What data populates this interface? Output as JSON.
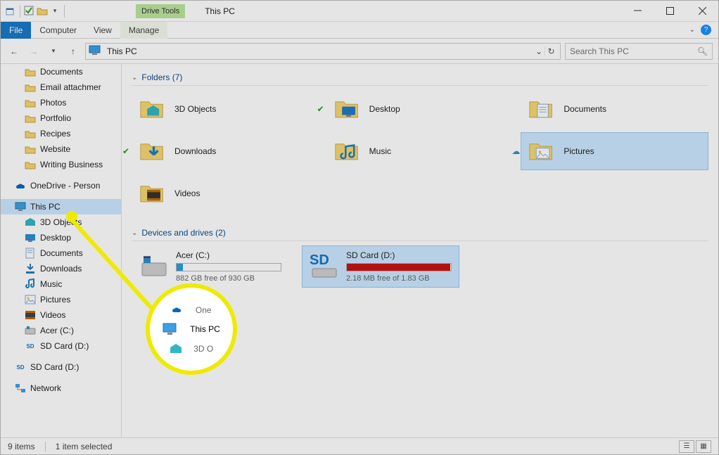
{
  "window": {
    "title": "This PC",
    "contextual_tab": "Drive Tools"
  },
  "ribbon": {
    "file": "File",
    "computer": "Computer",
    "view": "View",
    "manage": "Manage"
  },
  "address": {
    "location": "This PC"
  },
  "search": {
    "placeholder": "Search This PC"
  },
  "sidebar": {
    "top_items": [
      "Documents",
      "Email attachmer",
      "Photos",
      "Portfolio",
      "Recipes",
      "Website",
      "Writing Business"
    ],
    "onedrive": "OneDrive - Person",
    "this_pc": "This PC",
    "this_pc_children": [
      "3D Objects",
      "Desktop",
      "Documents",
      "Downloads",
      "Music",
      "Pictures",
      "Videos",
      "Acer (C:)",
      "SD Card (D:)"
    ],
    "sd_ext": "SD Card (D:)",
    "network": "Network"
  },
  "groups": {
    "folders_header": "Folders (7)",
    "drives_header": "Devices and drives (2)"
  },
  "folders": [
    {
      "label": "3D Objects",
      "badge": false
    },
    {
      "label": "Desktop",
      "badge": true
    },
    {
      "label": "Documents",
      "badge": false
    },
    {
      "label": "Downloads",
      "badge": true
    },
    {
      "label": "Music",
      "badge": false
    },
    {
      "label": "Pictures",
      "badge": false,
      "cloud": true,
      "selected": true
    },
    {
      "label": "Videos",
      "badge": false
    }
  ],
  "drives": [
    {
      "name": "Acer (C:)",
      "free": "882 GB free of 930 GB",
      "pct": 6,
      "color": "blue",
      "selected": false
    },
    {
      "name": "SD Card (D:)",
      "free": "2.18 MB free of 1.83 GB",
      "pct": 99,
      "color": "red",
      "selected": true
    }
  ],
  "status": {
    "items": "9 items",
    "selected": "1 item selected"
  },
  "callout": {
    "above": "One",
    "main": "This PC",
    "below": "3D O"
  }
}
